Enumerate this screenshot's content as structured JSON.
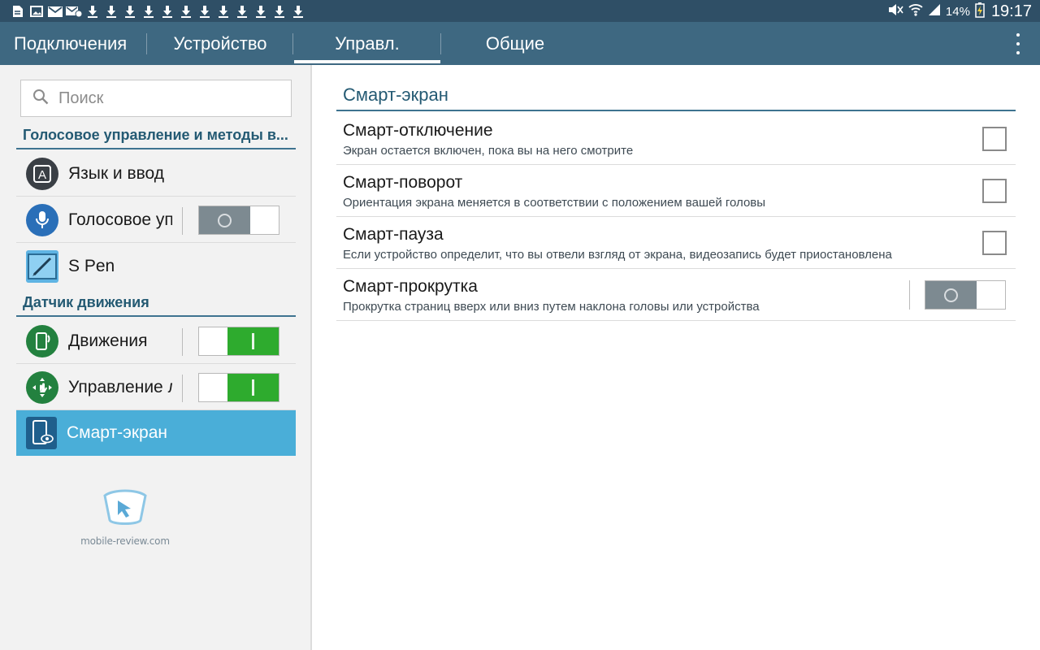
{
  "status_bar": {
    "notification_icons": [
      "document-icon",
      "image-icon",
      "email-icon",
      "email-alert-icon",
      "download-icon",
      "download-icon",
      "download-icon",
      "download-icon",
      "download-icon",
      "download-icon",
      "download-icon",
      "download-icon",
      "download-icon",
      "download-icon",
      "download-icon",
      "download-icon"
    ],
    "battery": "14%",
    "time": "19:17"
  },
  "tabs": [
    {
      "label": "Подключения",
      "selected": false
    },
    {
      "label": "Устройство",
      "selected": false
    },
    {
      "label": "Управл.",
      "selected": true
    },
    {
      "label": "Общие",
      "selected": false
    }
  ],
  "sidebar": {
    "search_placeholder": "Поиск",
    "section_voice": "Голосовое управление и методы в...",
    "section_motion": "Датчик движения",
    "items": [
      {
        "label": "Язык и ввод",
        "icon": "keyboard-a-icon",
        "toggle": null
      },
      {
        "label": "Голосовое управление",
        "icon": "microphone-icon",
        "toggle": "off"
      },
      {
        "label": "S Pen",
        "icon": "spen-icon",
        "toggle": null
      },
      {
        "label": "Движения",
        "icon": "motion-phone-icon",
        "toggle": "on"
      },
      {
        "label": "Управление ладонью",
        "icon": "palm-icon",
        "toggle": "on"
      },
      {
        "label": "Смарт-экран",
        "icon": "smart-screen-icon",
        "toggle": null,
        "selected": true
      }
    ],
    "watermark": "mobile-review.com"
  },
  "main": {
    "title": "Смарт-экран",
    "items": [
      {
        "title": "Смарт-отключение",
        "subtitle": "Экран остается включен, пока вы на него смотрите",
        "control": "checkbox",
        "checked": false
      },
      {
        "title": "Смарт-поворот",
        "subtitle": "Ориентация экрана меняется в соответствии с положением вашей головы",
        "control": "checkbox",
        "checked": false
      },
      {
        "title": "Смарт-пауза",
        "subtitle": "Если устройство определит, что вы отвели взгляд от экрана, видеозапись будет приостановлена",
        "control": "checkbox",
        "checked": false
      },
      {
        "title": "Смарт-прокрутка",
        "subtitle": "Прокрутка страниц вверх или вниз путем наклона головы или устройства",
        "control": "toggle",
        "state": "off"
      }
    ]
  },
  "colors": {
    "status_bar": "#2f4f66",
    "tab_bar": "#3e6881",
    "section_header": "#245a73",
    "selected_item": "#4aaed8",
    "toggle_on": "#2eab2e",
    "toggle_off": "#7d8a91"
  }
}
